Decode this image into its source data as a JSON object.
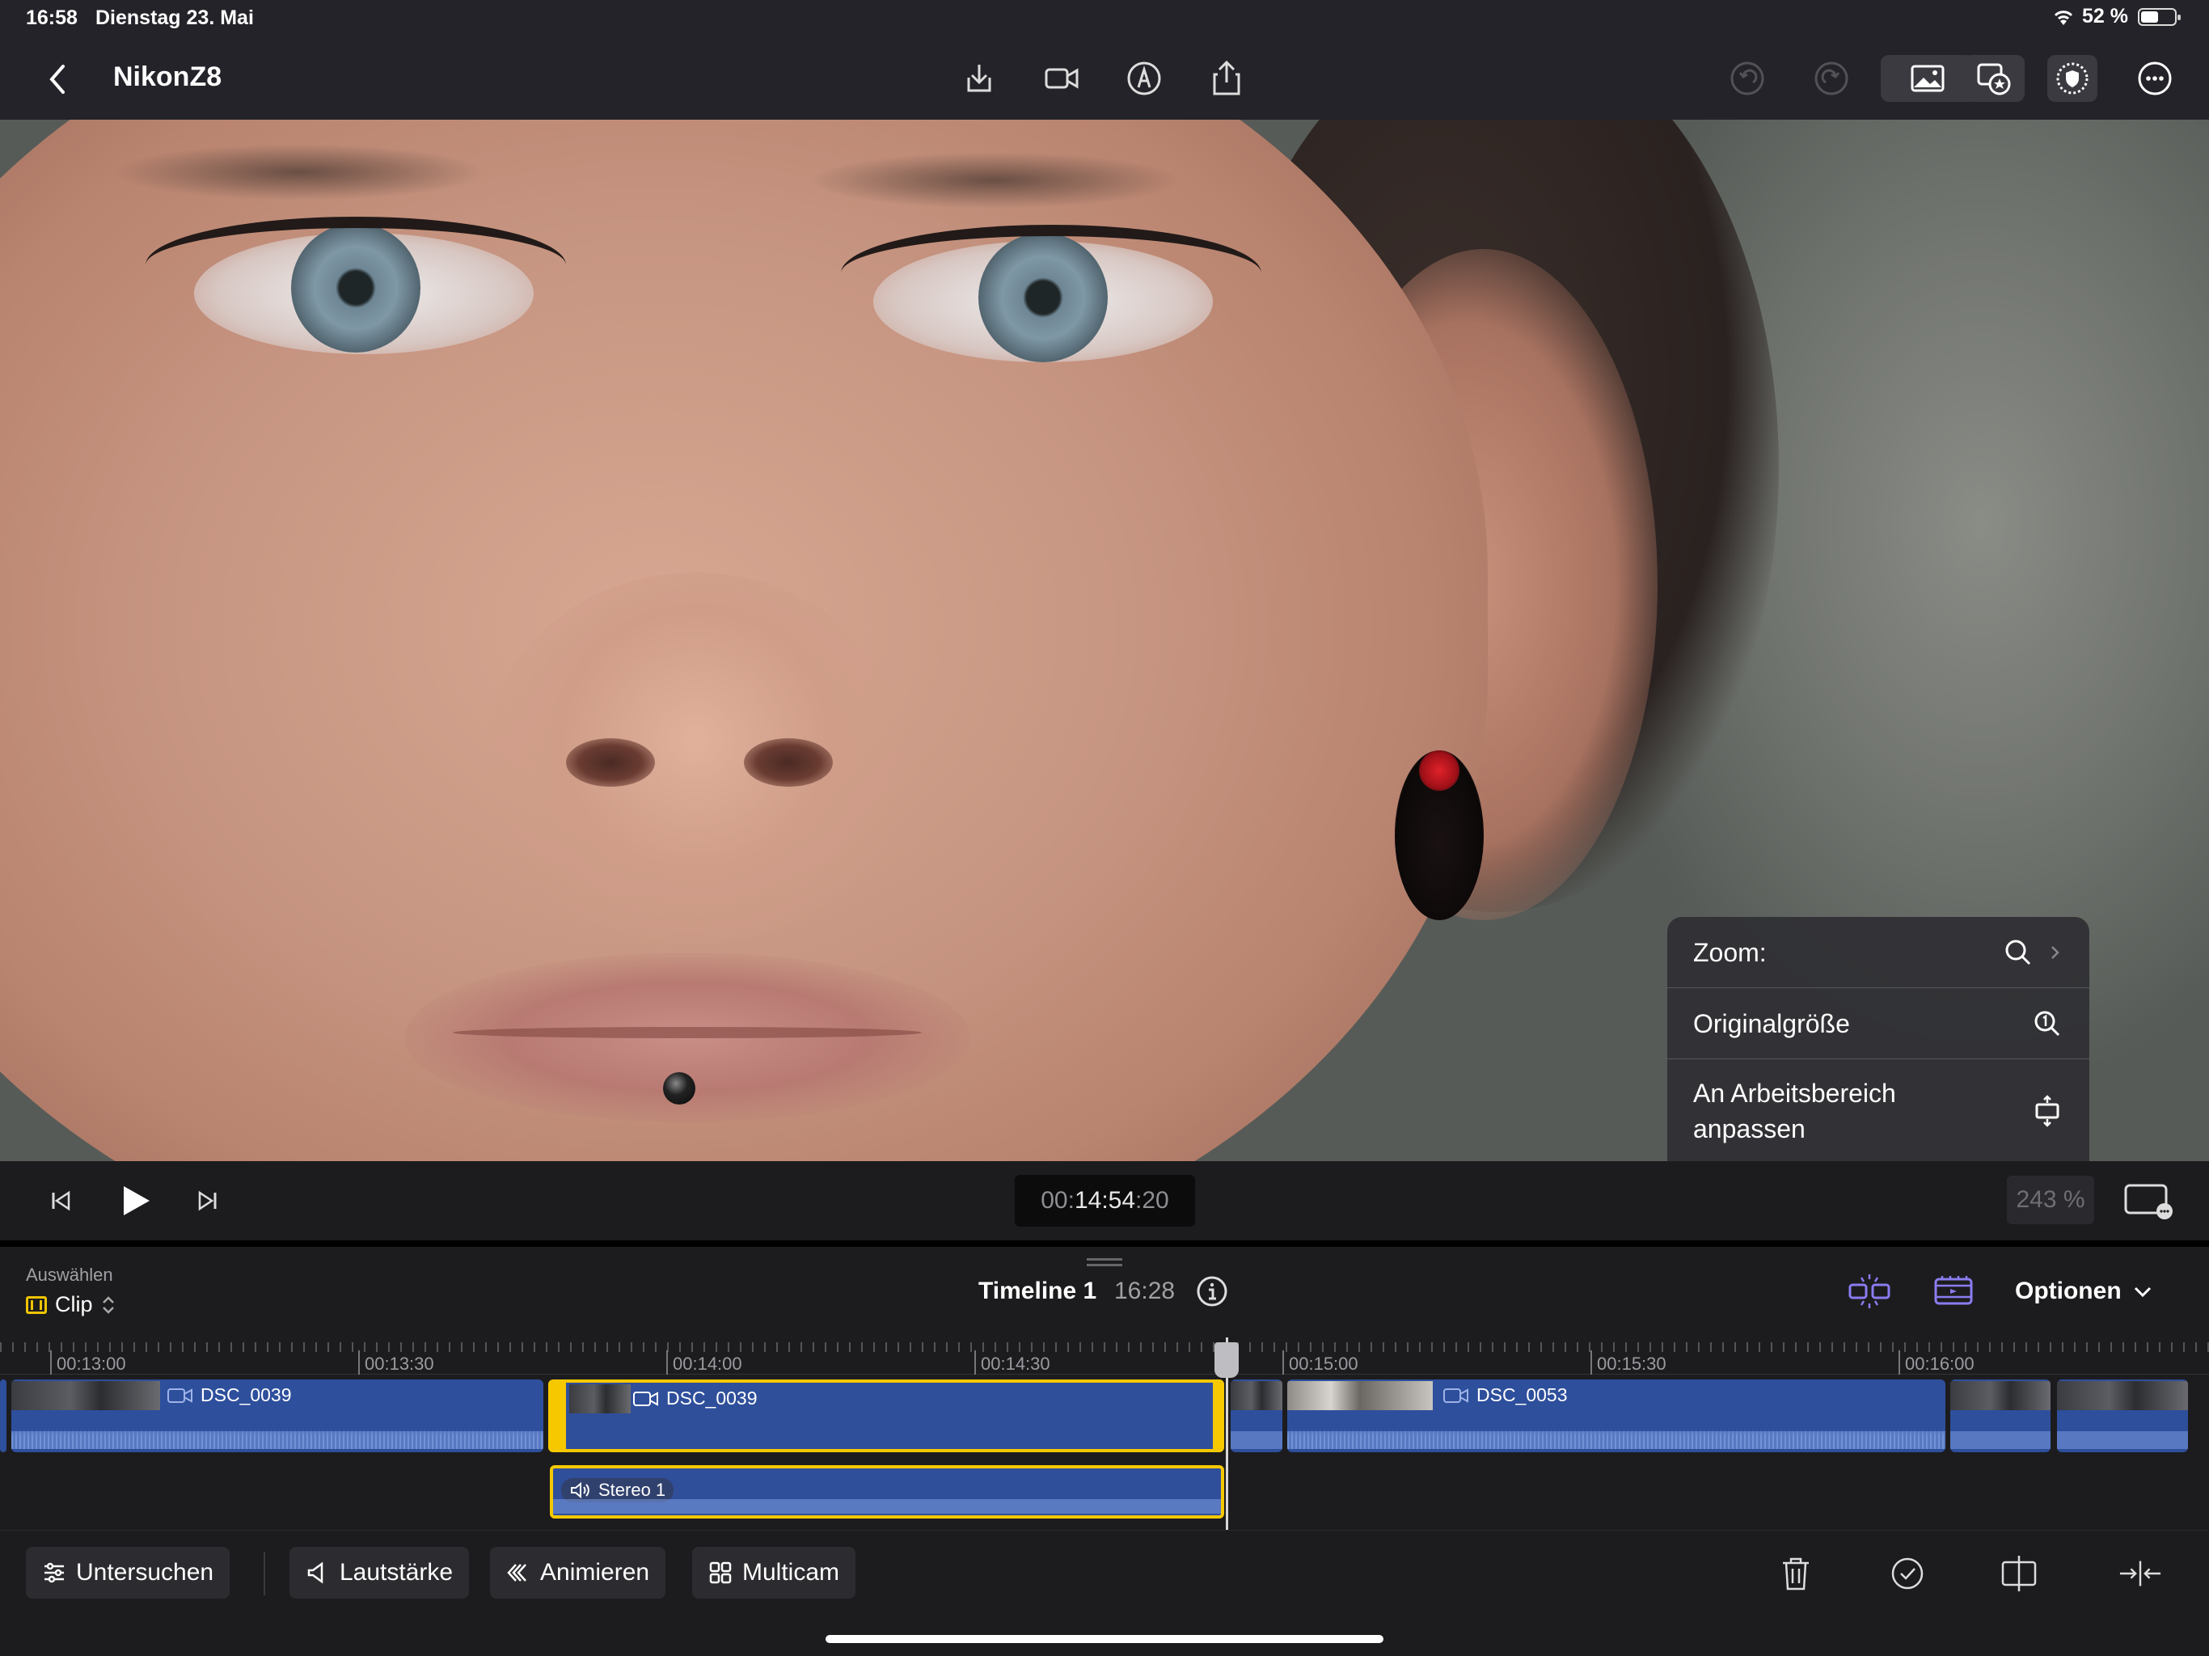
{
  "status": {
    "time": "16:58",
    "date": "Dienstag 23. Mai",
    "battery": "52 %",
    "battery_level": 0.52
  },
  "toolbar": {
    "project_title": "NikonZ8"
  },
  "zoom_menu": {
    "zoom_label": "Zoom:",
    "original_label": "Originalgröße",
    "fit_label": "An Arbeitsbereich anpassen"
  },
  "transport": {
    "timecode_prefix": "00:",
    "timecode_main": "14:54",
    "timecode_suffix": ":20",
    "zoom_percent": "243 %"
  },
  "timeline_header": {
    "select_label": "Auswählen",
    "select_value": "Clip",
    "title": "Timeline 1",
    "duration": "16:28",
    "options_label": "Optionen"
  },
  "ruler": [
    "00:13:00",
    "00:13:30",
    "00:14:00",
    "00:14:30",
    "00:15:00",
    "00:15:30",
    "00:16:00"
  ],
  "clips": {
    "clip1": "DSC_0039",
    "clip2": "DSC_0039",
    "clip3": "DSC_0053",
    "audio": "Stereo 1"
  },
  "bottom_bar": {
    "inspect": "Untersuchen",
    "volume": "Lautstärke",
    "animate": "Animieren",
    "multicam": "Multicam"
  },
  "colors": {
    "accent_yellow": "#f6c800",
    "clip_blue": "#2e4f9c",
    "icon_purple": "#8a7cf0"
  }
}
